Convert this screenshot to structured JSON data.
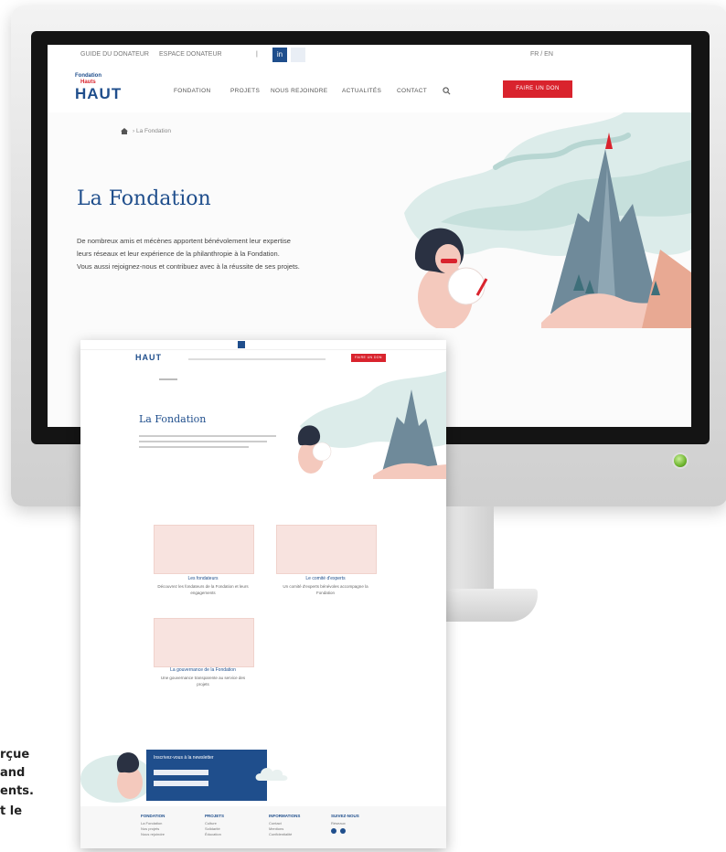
{
  "site": {
    "topbar": {
      "item1": "GUIDE DU DONATEUR",
      "item2": "ESPACE DONATEUR",
      "social": "in",
      "right": "FR / EN"
    },
    "logo_small": "Fondation",
    "logo_mid": "Hauts",
    "logo_big": "HAUT",
    "nav": [
      "FONDATION",
      "PROJETS",
      "NOUS REJOINDRE",
      "ACTUALITÉS",
      "CONTACT"
    ],
    "cta": "FAIRE UN DON",
    "breadcrumb": "La Fondation",
    "title": "La Fondation",
    "intro": [
      "De nombreux amis et mécènes apportent bénévolement leur expertise",
      "leurs réseaux et leur expérience de la philanthropie à la Fondation.",
      "Vous aussi rejoignez-nous et contribuez avec à la réussite de ses projets."
    ]
  },
  "mockup": {
    "title": "La Fondation",
    "cta": "FAIRE UN DON",
    "cards": [
      {
        "title": "Les fondateurs",
        "text": "Découvrez les fondateurs de la Fondation et leurs engagements"
      },
      {
        "title": "Le comité d'experts",
        "text": "Un comité d'experts bénévoles accompagne la Fondation"
      },
      {
        "title": "La gouvernance de la Fondation",
        "text": "Une gouvernance transparente au service des projets"
      }
    ],
    "newsletter": "Inscrivez-vous à la newsletter",
    "footer": [
      {
        "title": "FONDATION",
        "links": [
          "La Fondation",
          "Nos projets",
          "Nous rejoindre"
        ]
      },
      {
        "title": "PROJETS",
        "links": [
          "Culture",
          "Solidarité",
          "Éducation"
        ]
      },
      {
        "title": "INFORMATIONS",
        "links": [
          "Contact",
          "Mentions",
          "Confidentialité"
        ]
      },
      {
        "title": "SUIVEZ-NOUS",
        "links": [
          "Réseaux"
        ]
      }
    ]
  },
  "side_text": [
    "rçue",
    "and",
    "ents.",
    "t le"
  ],
  "colors": {
    "brand_blue": "#1f4e8c",
    "cta_red": "#d9232d",
    "card_pink": "#f8e3df",
    "illustration_mint": "#cfe6e3"
  }
}
